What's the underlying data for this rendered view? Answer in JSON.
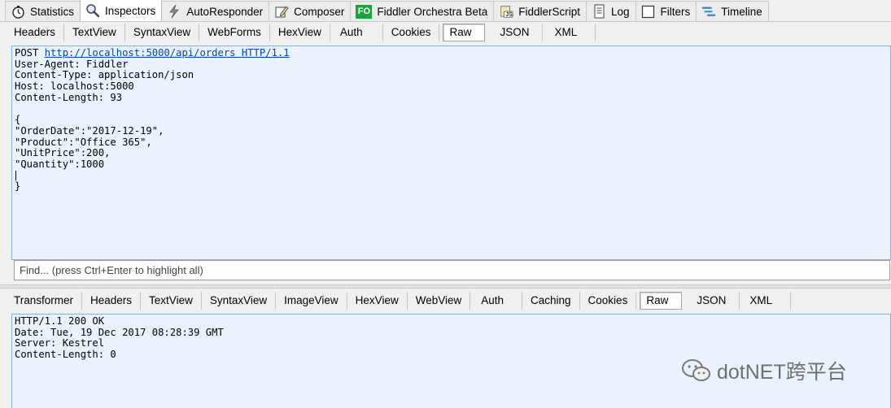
{
  "top_tabs": [
    {
      "label": "Statistics",
      "icon": "stopwatch-icon"
    },
    {
      "label": "Inspectors",
      "icon": "magnifier-icon",
      "active": true
    },
    {
      "label": "AutoResponder",
      "icon": "lightning-icon"
    },
    {
      "label": "Composer",
      "icon": "pencil-icon"
    },
    {
      "label": "Fiddler Orchestra Beta",
      "icon": "fo-icon",
      "icon_text": "FO"
    },
    {
      "label": "FiddlerScript",
      "icon": "script-icon",
      "icon_text": "JS"
    },
    {
      "label": "Log",
      "icon": "document-icon"
    },
    {
      "label": "Filters",
      "icon": "checkbox-icon"
    },
    {
      "label": "Timeline",
      "icon": "timeline-icon"
    }
  ],
  "request_tabs": [
    "Headers",
    "TextView",
    "SyntaxView",
    "WebForms",
    "HexView",
    "Auth",
    "Cookies",
    "Raw",
    "JSON",
    "XML"
  ],
  "request_active": "Raw",
  "request": {
    "method": "POST",
    "url": "http://localhost:5000/api/orders HTTP/1.1",
    "lines": [
      "User-Agent: Fiddler",
      "Content-Type: application/json",
      "Host: localhost:5000",
      "Content-Length: 93",
      "",
      "{",
      "\"OrderDate\":\"2017-12-19\",",
      "\"Product\":\"Office 365\",",
      "\"UnitPrice\":200,",
      "\"Quantity\":1000",
      "",
      "}"
    ]
  },
  "find_placeholder": "Find... (press Ctrl+Enter to highlight all)",
  "response_tabs": [
    "Transformer",
    "Headers",
    "TextView",
    "SyntaxView",
    "ImageView",
    "HexView",
    "WebView",
    "Auth",
    "Caching",
    "Cookies",
    "Raw",
    "JSON",
    "XML"
  ],
  "response_active": "Raw",
  "response": {
    "lines": [
      "HTTP/1.1 200 OK",
      "Date: Tue, 19 Dec 2017 08:28:39 GMT",
      "Server: Kestrel",
      "Content-Length: 0"
    ]
  },
  "watermark": {
    "text": "dotNET跨平台",
    "icon": "wechat-icon"
  },
  "colors": {
    "pane_bg": "#eaf3fd",
    "pane_border": "#8cb0d8",
    "link": "#0645ad",
    "fo_green": "#1aa33c"
  }
}
